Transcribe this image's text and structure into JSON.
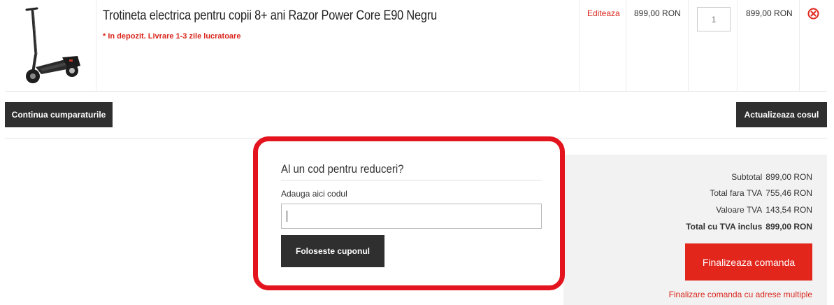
{
  "cart": {
    "item": {
      "image_alt": "electric-scooter",
      "name": "Trotineta electrica pentru copii 8+ ani Razor Power Core E90 Negru",
      "stock_note": "* In depozit. Livrare 1-3 zile lucratoare",
      "edit_label": "Editeaza",
      "unit_price": "899,00 RON",
      "quantity": "1",
      "row_total": "899,00 RON",
      "remove_icon": "remove-icon"
    },
    "continue_label": "Continua cumparaturile",
    "update_label": "Actualizeaza cosul"
  },
  "coupon": {
    "title": "Al un cod pentru reduceri?",
    "label": "Adauga aici codul",
    "value": "",
    "button_label": "Foloseste cuponul"
  },
  "totals": {
    "subtotal_label": "Subtotal",
    "subtotal_value": "899,00 RON",
    "net_label": "Total fara TVA",
    "net_value": "755,46 RON",
    "vat_label": "Valoare TVA",
    "vat_value": "143,54 RON",
    "gross_label": "Total cu TVA inclus",
    "gross_value": "899,00 RON",
    "checkout_label": "Finalizeaza comanda",
    "multi_address_label": "Finalizare comanda cu adrese multiple"
  },
  "colors": {
    "accent": "#e2261c",
    "dark_button": "#2f2f2f",
    "highlight": "#e3141e"
  }
}
